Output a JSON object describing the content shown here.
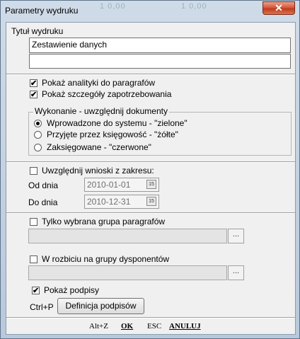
{
  "window": {
    "title": "Parametry wydruku",
    "close_glyph": "✕",
    "ghost_left": "1  0,00",
    "ghost_right": "1  0,00"
  },
  "title_section": {
    "label": "Tytuł wydruku",
    "line1": "Zestawienie danych",
    "line2": ""
  },
  "options": {
    "show_analytics": {
      "label": "Pokaż analityki do paragrafów",
      "checked": true
    },
    "show_details": {
      "label": "Pokaż szczegóły zapotrzebowania",
      "checked": true
    }
  },
  "execution_group": {
    "legend": "Wykonanie - uwzględnij dokumenty",
    "radios": [
      {
        "label": "Wprowadzone do systemu - \"zielone\"",
        "selected": true
      },
      {
        "label": "Przyjęte przez księgowość - \"żółte\"",
        "selected": false
      },
      {
        "label": "Zaksięgowane - \"czerwone\"",
        "selected": false
      }
    ]
  },
  "proposals": {
    "checkbox_label": "Uwzględnij wnioski z zakresu:",
    "checked": false,
    "from_label": "Od dnia",
    "from_value": "2010-01-01",
    "to_label": "Do dnia",
    "to_value": "2010-12-31",
    "calendar_glyph": "15"
  },
  "paragraph_group": {
    "checkbox_label": "Tylko wybrana grupa paragrafów",
    "checked": false,
    "value": "",
    "dots": "..."
  },
  "disposers": {
    "checkbox_label": "W rozbiciu na grupy dysponentów",
    "checked": false,
    "value": "",
    "dots": "..."
  },
  "signatures": {
    "checkbox_label": "Pokaż podpisy",
    "checked": true,
    "shortcut": "Ctrl+P",
    "button_label": "Definicja podpisów"
  },
  "footer": {
    "ok_shortcut": "Alt+Z",
    "ok_label": "OK",
    "cancel_shortcut": "ESC",
    "cancel_label": "ANULUJ"
  },
  "check_glyph": "✔"
}
